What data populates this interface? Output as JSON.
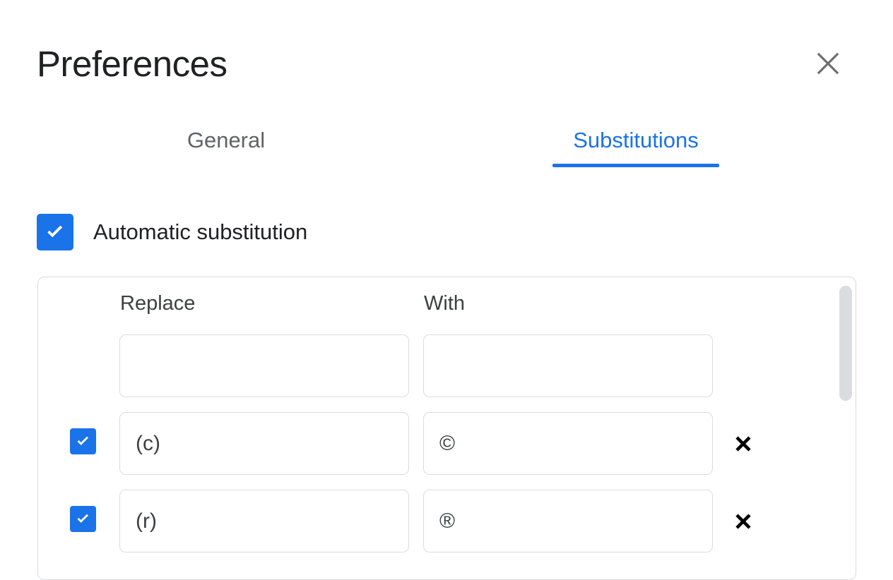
{
  "dialog": {
    "title": "Preferences",
    "close_icon": "close-icon"
  },
  "tabs": [
    {
      "label": "General",
      "active": false
    },
    {
      "label": "Substitutions",
      "active": true
    }
  ],
  "auto_substitution": {
    "label": "Automatic substitution",
    "checked": true,
    "icon": "checkmark-icon"
  },
  "substitutions_table": {
    "columns": [
      "Replace",
      "With"
    ],
    "rows": [
      {
        "has_checkbox": false,
        "checked": false,
        "replace": "",
        "with": "",
        "replace_placeholder": "",
        "with_placeholder": "",
        "has_delete": false,
        "delete_icon": ""
      },
      {
        "has_checkbox": true,
        "checked": true,
        "replace": "(c)",
        "with": "©",
        "replace_placeholder": "",
        "with_placeholder": "",
        "has_delete": true,
        "delete_icon": "close-bold-icon"
      },
      {
        "has_checkbox": true,
        "checked": true,
        "replace": "(r)",
        "with": "®",
        "replace_placeholder": "",
        "with_placeholder": "",
        "has_delete": true,
        "delete_icon": "close-bold-icon"
      }
    ]
  },
  "scrollbar": {
    "name": "vertical-scrollbar"
  },
  "colors": {
    "accent": "#1a73e8",
    "text_primary": "#202124",
    "text_secondary": "#5f6368",
    "border": "#dadce0",
    "scroll_thumb": "#dadce0",
    "close_icon": "#6e6e6e"
  }
}
